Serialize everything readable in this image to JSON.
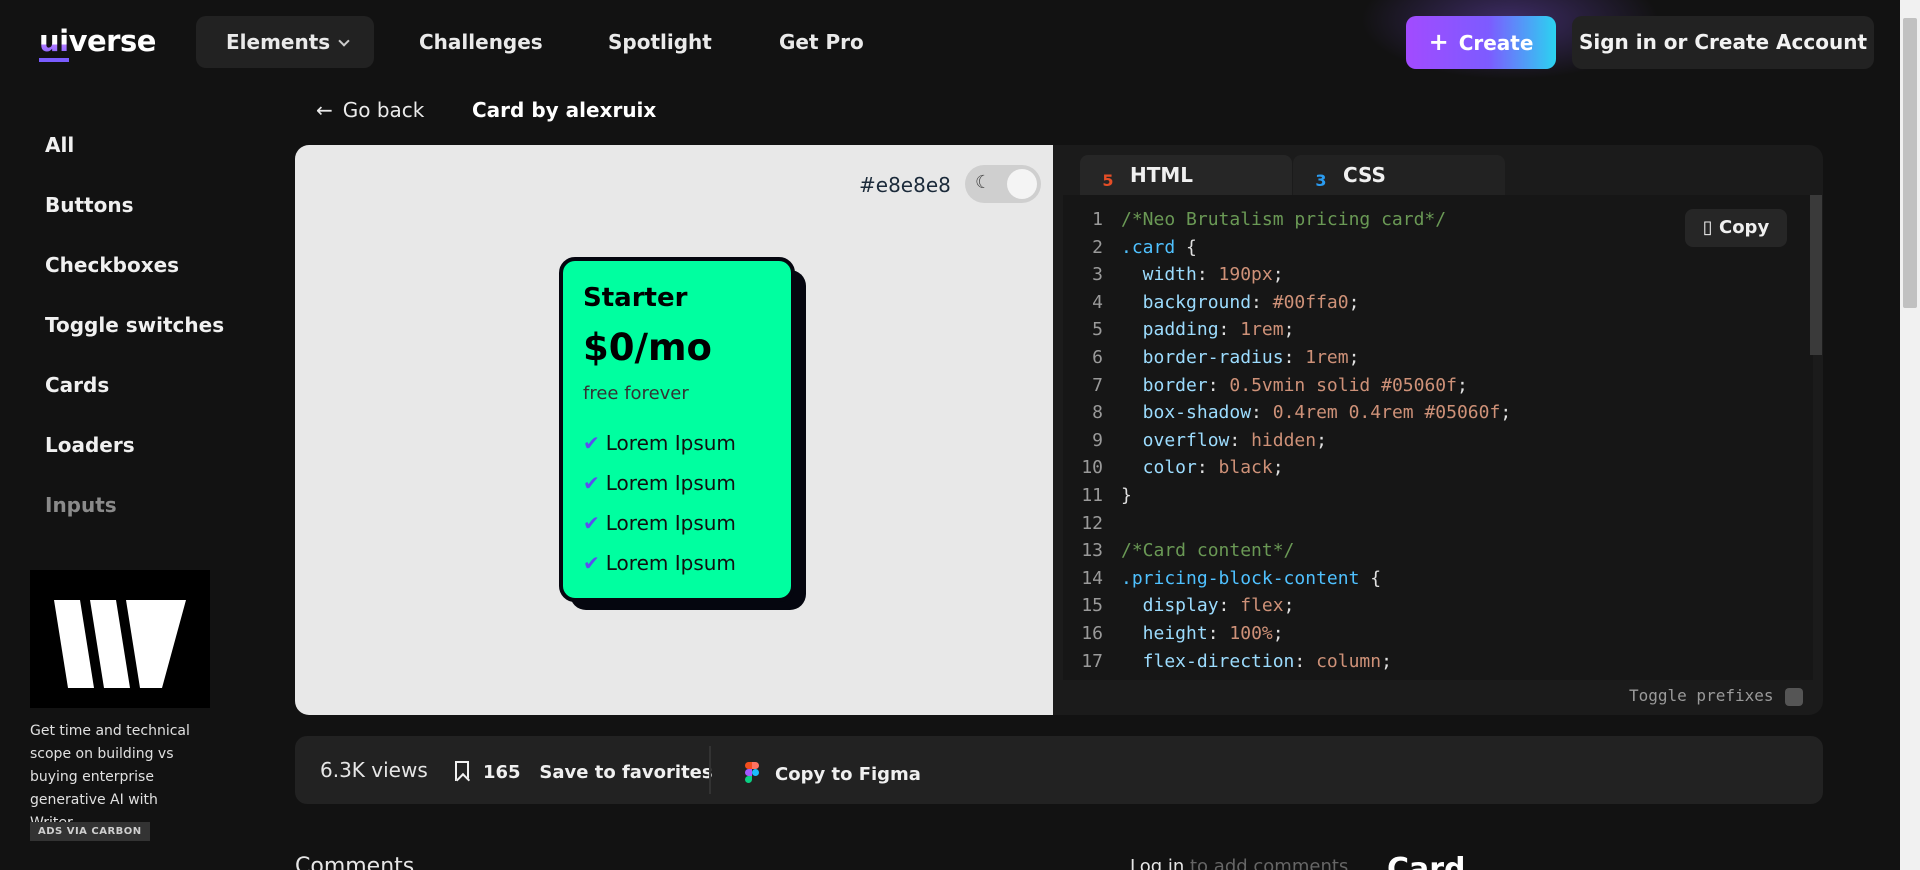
{
  "logo": {
    "text_a": "ui",
    "text_b": "verse"
  },
  "nav": {
    "elements": "Elements",
    "challenges": "Challenges",
    "spotlight": "Spotlight",
    "get_pro": "Get Pro",
    "create": "Create",
    "signin": "Sign in or Create Account"
  },
  "sidebar": {
    "items": [
      {
        "label": "All"
      },
      {
        "label": "Buttons"
      },
      {
        "label": "Checkboxes"
      },
      {
        "label": "Toggle switches"
      },
      {
        "label": "Cards"
      },
      {
        "label": "Loaders"
      },
      {
        "label": "Inputs"
      }
    ],
    "ad_text": "Get time and technical scope on building vs buying enterprise generative AI with Writer.",
    "ad_badge": "ADS VIA CARBON"
  },
  "breadcrumb": {
    "go_back": "Go back",
    "title": "Card by alexruix"
  },
  "preview": {
    "background_hex": "#e8e8e8",
    "card": {
      "plan": "Starter",
      "price": "$0/mo",
      "subtitle": "free forever",
      "features": [
        "Lorem Ipsum",
        "Lorem Ipsum",
        "Lorem Ipsum",
        "Lorem Ipsum"
      ],
      "color": "#00ffa0",
      "border_color": "#05060f"
    }
  },
  "code": {
    "tabs": [
      "HTML",
      "CSS"
    ],
    "copy_label": "Copy",
    "toggle_prefixes": "Toggle prefixes",
    "lines": [
      [
        [
          "c-comment",
          "/*Neo Brutalism pricing card*/"
        ]
      ],
      [
        [
          "c-sel",
          ".card"
        ],
        [
          "c-punc",
          " {"
        ]
      ],
      [
        [
          "c-prop",
          "  width"
        ],
        [
          "c-punc",
          ": "
        ],
        [
          "c-val",
          "190px"
        ],
        [
          "c-punc",
          ";"
        ]
      ],
      [
        [
          "c-prop",
          "  background"
        ],
        [
          "c-punc",
          ": "
        ],
        [
          "c-val",
          "#00ffa0"
        ],
        [
          "c-punc",
          ";"
        ]
      ],
      [
        [
          "c-prop",
          "  padding"
        ],
        [
          "c-punc",
          ": "
        ],
        [
          "c-val",
          "1rem"
        ],
        [
          "c-punc",
          ";"
        ]
      ],
      [
        [
          "c-prop",
          "  border-radius"
        ],
        [
          "c-punc",
          ": "
        ],
        [
          "c-val",
          "1rem"
        ],
        [
          "c-punc",
          ";"
        ]
      ],
      [
        [
          "c-prop",
          "  border"
        ],
        [
          "c-punc",
          ": "
        ],
        [
          "c-val",
          "0.5vmin solid #05060f"
        ],
        [
          "c-punc",
          ";"
        ]
      ],
      [
        [
          "c-prop",
          "  box-shadow"
        ],
        [
          "c-punc",
          ": "
        ],
        [
          "c-val",
          "0.4rem 0.4rem #05060f"
        ],
        [
          "c-punc",
          ";"
        ]
      ],
      [
        [
          "c-prop",
          "  overflow"
        ],
        [
          "c-punc",
          ": "
        ],
        [
          "c-val",
          "hidden"
        ],
        [
          "c-punc",
          ";"
        ]
      ],
      [
        [
          "c-prop",
          "  color"
        ],
        [
          "c-punc",
          ": "
        ],
        [
          "c-val",
          "black"
        ],
        [
          "c-punc",
          ";"
        ]
      ],
      [
        [
          "c-punc",
          "}"
        ]
      ],
      [
        [
          "c-punc",
          ""
        ]
      ],
      [
        [
          "c-comment",
          "/*Card content*/"
        ]
      ],
      [
        [
          "c-sel",
          ".pricing-block-content"
        ],
        [
          "c-punc",
          " {"
        ]
      ],
      [
        [
          "c-prop",
          "  display"
        ],
        [
          "c-punc",
          ": "
        ],
        [
          "c-val",
          "flex"
        ],
        [
          "c-punc",
          ";"
        ]
      ],
      [
        [
          "c-prop",
          "  height"
        ],
        [
          "c-punc",
          ": "
        ],
        [
          "c-val",
          "100%"
        ],
        [
          "c-punc",
          ";"
        ]
      ],
      [
        [
          "c-prop",
          "  flex-direction"
        ],
        [
          "c-punc",
          ": "
        ],
        [
          "c-val",
          "column"
        ],
        [
          "c-punc",
          ";"
        ]
      ]
    ]
  },
  "stats": {
    "views": "6.3K views",
    "favorites_count": "165",
    "favorites_label": "Save to favorites",
    "figma_label": "Copy to Figma"
  },
  "bottom": {
    "comments": "Comments",
    "login": "Log in",
    "login_rest": " to add comments",
    "card_heading": "Card"
  },
  "icons": {
    "back": "arrow-left-icon",
    "moon": "moon-icon",
    "check": "check-icon",
    "copy": "clipboard-icon",
    "bookmark": "bookmark-icon",
    "figma": "figma-icon",
    "html": "html5-icon",
    "css": "css3-icon"
  }
}
